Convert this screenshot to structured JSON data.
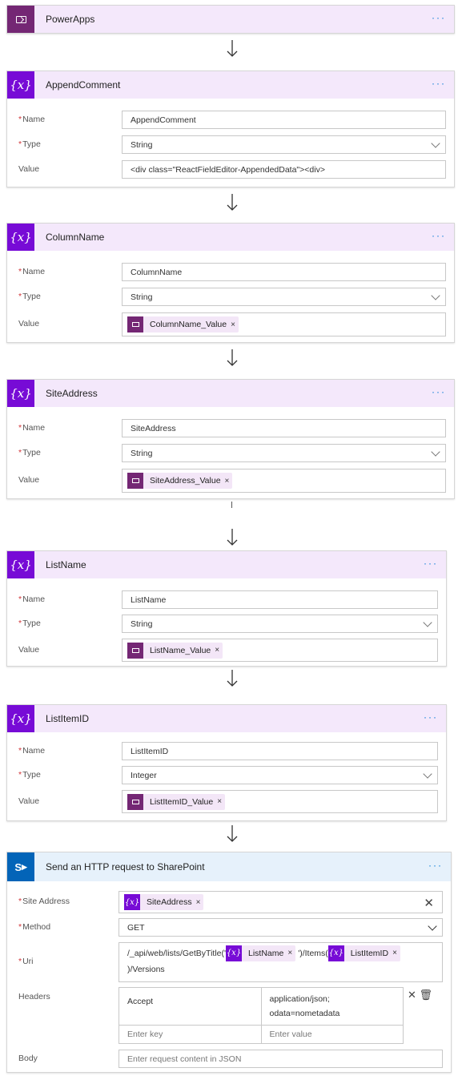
{
  "trigger": {
    "title": "PowerApps",
    "more": "···"
  },
  "vars": [
    {
      "title": "AppendComment",
      "name_label": "Name",
      "name": "AppendComment",
      "type_label": "Type",
      "type": "String",
      "value_label": "Value",
      "value_text": "<div class=\"ReactFieldEditor-AppendedData\"><div>"
    },
    {
      "title": "ColumnName",
      "name_label": "Name",
      "name": "ColumnName",
      "type_label": "Type",
      "type": "String",
      "value_label": "Value",
      "value_token": "ColumnName_Value"
    },
    {
      "title": "SiteAddress",
      "name_label": "Name",
      "name": "SiteAddress",
      "type_label": "Type",
      "type": "String",
      "value_label": "Value",
      "value_token": "SiteAddress_Value"
    },
    {
      "title": "ListName",
      "name_label": "Name",
      "name": "ListName",
      "type_label": "Type",
      "type": "String",
      "value_label": "Value",
      "value_token": "ListName_Value"
    },
    {
      "title": "ListItemID",
      "name_label": "Name",
      "name": "ListItemID",
      "type_label": "Type",
      "type": "Integer",
      "value_label": "Value",
      "value_token": "ListItemID_Value"
    }
  ],
  "http": {
    "title": "Send an HTTP request to SharePoint",
    "icon_text": "S",
    "site_label": "Site Address",
    "site_token": "SiteAddress",
    "method_label": "Method",
    "method": "GET",
    "uri_label": "Uri",
    "uri_part1": "/_api/web/lists/GetByTitle('",
    "uri_token1": "ListName",
    "uri_part2": "')/Items(",
    "uri_token2": "ListItemID",
    "uri_part3": ")/Versions",
    "headers_label": "Headers",
    "header_key": "Accept",
    "header_value": "application/json; odata=nometadata",
    "key_placeholder": "Enter key",
    "value_placeholder": "Enter value",
    "body_label": "Body",
    "body_placeholder": "Enter request content in JSON"
  },
  "common": {
    "required_mark": "*",
    "remove": "×",
    "var_icon": "{x}",
    "clear": "✕"
  },
  "colors": {
    "variable_purple": "#770bd6",
    "powerapps_purple": "#742774",
    "sharepoint_blue": "#0364b8",
    "link_blue": "#0078d4"
  }
}
